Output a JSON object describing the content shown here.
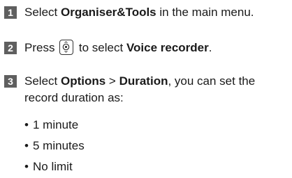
{
  "steps": [
    {
      "number": "1",
      "parts": [
        "Select ",
        "Organiser&Tools",
        " in the main menu."
      ]
    },
    {
      "number": "2",
      "parts": [
        "Press ",
        " to select ",
        "Voice recorder",
        "."
      ],
      "key_icon": "navigation-key-icon"
    },
    {
      "number": "3",
      "line1": [
        "Select ",
        "Options",
        " > ",
        "Duration",
        ", you can set the"
      ],
      "line2": "record duration as:"
    }
  ],
  "bullets": [
    "1 minute",
    "5 minutes",
    "No limit"
  ],
  "bullet_symbol": "•",
  "colors": {
    "badge": "#5f5f5f",
    "text": "#1a1a1a"
  }
}
